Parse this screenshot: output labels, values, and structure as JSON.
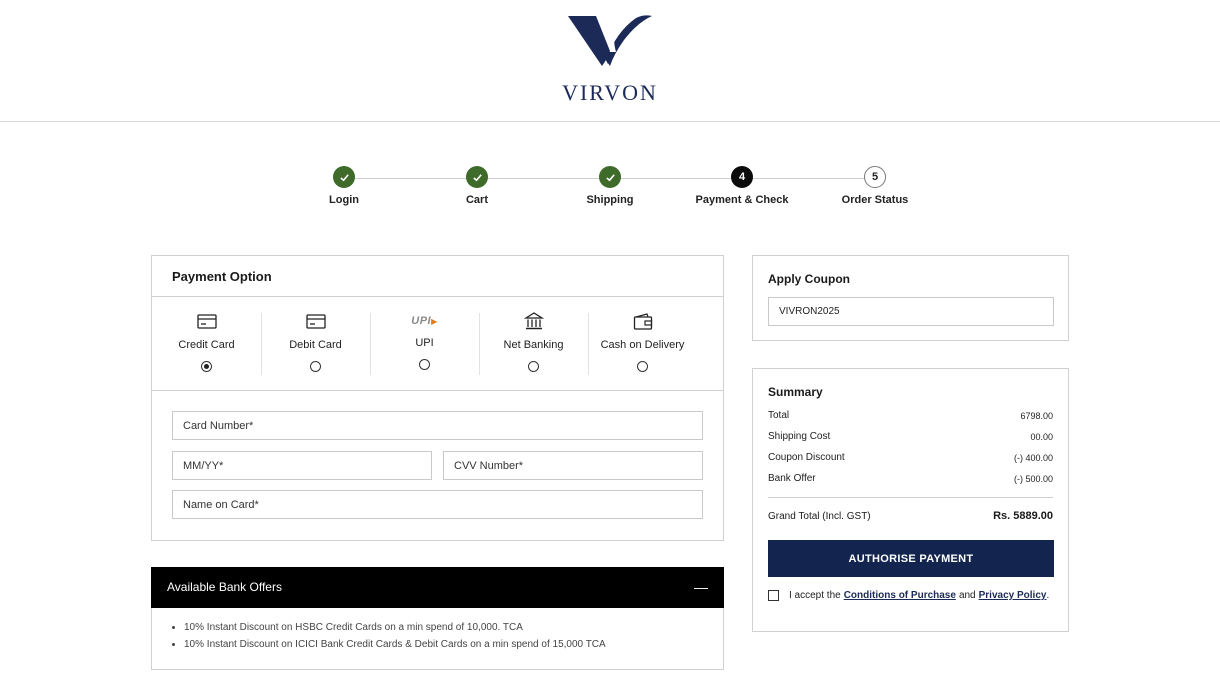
{
  "brand": {
    "name": "VIRVON",
    "accent": "#1b2a57"
  },
  "stepper": {
    "steps": [
      {
        "label": "Login",
        "state": "done",
        "number": ""
      },
      {
        "label": "Cart",
        "state": "done",
        "number": ""
      },
      {
        "label": "Shipping",
        "state": "done",
        "number": ""
      },
      {
        "label": "Payment & Check",
        "state": "active",
        "number": "4"
      },
      {
        "label": "Order Status",
        "state": "pending",
        "number": "5"
      }
    ]
  },
  "payment": {
    "title": "Payment Option",
    "methods": [
      {
        "label": "Credit Card",
        "icon": "credit-card-icon",
        "selected": true
      },
      {
        "label": "Debit Card",
        "icon": "debit-card-icon",
        "selected": false
      },
      {
        "label": "UPI",
        "icon": "upi-logo-icon",
        "icon_text": "UPI",
        "selected": false
      },
      {
        "label": "Net Banking",
        "icon": "bank-icon",
        "selected": false
      },
      {
        "label": "Cash on Delivery",
        "icon": "wallet-icon",
        "selected": false
      }
    ],
    "fields": {
      "card_number": "Card Number*",
      "expiry": "MM/YY*",
      "cvv": "CVV Number*",
      "name_on_card": "Name on Card*"
    }
  },
  "offers": {
    "title": "Available Bank Offers",
    "toggle": "—",
    "items": [
      "10% Instant Discount on HSBC Credit Cards on a min spend of 10,000. TCA",
      "10% Instant Discount on ICICI Bank Credit Cards & Debit Cards on a min spend of 15,000 TCA"
    ]
  },
  "coupon": {
    "title": "Apply Coupon",
    "value": "VIVRON2025"
  },
  "summary": {
    "title": "Summary",
    "rows": [
      {
        "label": "Total",
        "value": "6798.00"
      },
      {
        "label": "Shipping Cost",
        "value": "00.00"
      },
      {
        "label": "Coupon Discount",
        "value": "(-) 400.00"
      },
      {
        "label": "Bank Offer",
        "value": "(-) 500.00"
      }
    ],
    "grand_total_label": "Grand Total (Incl. GST)",
    "grand_total_value": "Rs. 5889.00",
    "button": "AUTHORISE PAYMENT",
    "terms": {
      "prefix": "I accept the",
      "link1": "Conditions of Purchase",
      "joiner": "and",
      "link2": "Privacy Policy",
      "suffix": "."
    }
  },
  "colors": {
    "done": "#3e6a2a",
    "button": "#13254f",
    "offers_bar": "#000000"
  }
}
